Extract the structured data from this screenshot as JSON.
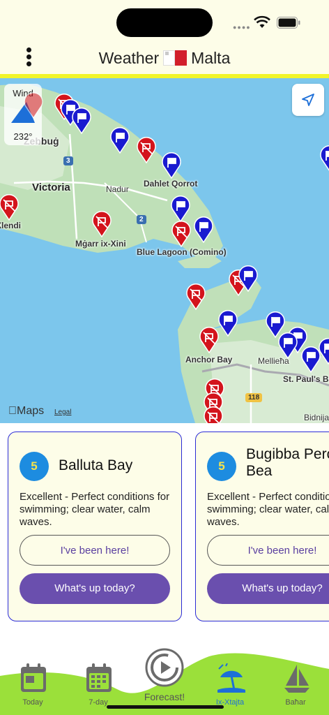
{
  "header": {
    "title_left": "Weather",
    "title_right": "Malta"
  },
  "map": {
    "wind": {
      "label": "Wind",
      "value": "232°"
    },
    "places": [
      "Żebbuġ",
      "Victoria",
      "Nadur",
      "Dahlet Qorrot",
      "Xlendi",
      "Mġarr ix-Xini",
      "Blue Lagoon (Comino)",
      "Anchor Bay",
      "Mellieħa",
      "St. Paul's Bay",
      "Bidnija"
    ],
    "road_numbers": [
      "3",
      "2",
      "118"
    ],
    "attribution": {
      "logo": "Maps",
      "legal": "Legal"
    }
  },
  "cards": [
    {
      "score": "5",
      "name": "Balluta Bay",
      "description": "Excellent - Perfect conditions for swimming; clear water, calm waves.",
      "been_here": "I've been here!",
      "whats_up": "What's up today?"
    },
    {
      "score": "5",
      "name": "Bugibba Perched Bea",
      "description": "Excellent - Perfect conditions for swimming; clear water, calm waves.",
      "been_here": "I've been here!",
      "whats_up": "What's up today?"
    }
  ],
  "tabs": [
    {
      "label": "Today",
      "icon": "calendar-day-icon"
    },
    {
      "label": "7-day",
      "icon": "calendar-week-icon"
    },
    {
      "label": "Forecast!",
      "icon": "play-circle-icon"
    },
    {
      "label": "Ix-Xtajta",
      "icon": "beach-umbrella-icon",
      "active": true
    },
    {
      "label": "Baħar",
      "icon": "sailboat-icon"
    }
  ],
  "colors": {
    "accent": "#6a4fae",
    "card_border": "#2b2bd6",
    "header_bg": "#fdfde8",
    "header_line": "#f1f52a",
    "sea": "#7cc6ec",
    "tab_wave": "#9be03a",
    "pin_red": "#d3141c",
    "pin_blue": "#1a1ad0"
  }
}
